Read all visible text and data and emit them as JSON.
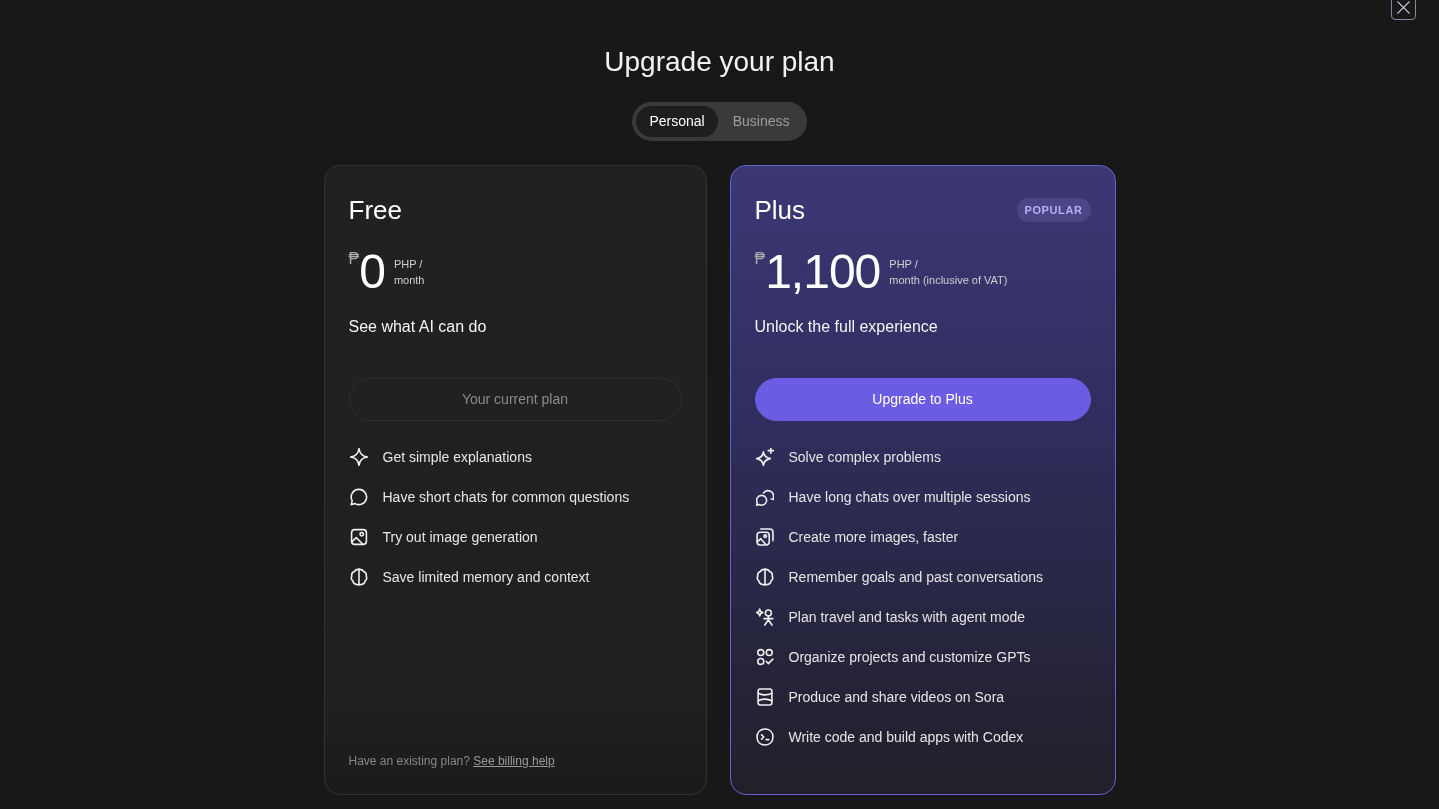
{
  "title": "Upgrade your plan",
  "tabs": [
    {
      "label": "Personal",
      "selected": true
    },
    {
      "label": "Business",
      "selected": false
    }
  ],
  "plans": [
    {
      "name": "Free",
      "highlighted": false,
      "currency": "₱",
      "price": "0",
      "period": [
        "PHP /",
        "month"
      ],
      "tagline": "See what AI can do",
      "button": {
        "label": "Your current plan",
        "disabled": true
      },
      "features": [
        "Get simple explanations",
        "Have short chats for common questions",
        "Try out image generation",
        "Save limited memory and context"
      ],
      "footer": {
        "text": "Have an existing plan?",
        "link": "See billing help"
      }
    },
    {
      "name": "Plus",
      "highlighted": true,
      "badge": "POPULAR",
      "currency": "₱",
      "price": "1,100",
      "period": [
        "PHP /",
        "month (inclusive of VAT)"
      ],
      "tagline": "Unlock the full experience",
      "button": {
        "label": "Upgrade to Plus",
        "disabled": false
      },
      "features": [
        "Solve complex problems",
        "Have long chats over multiple sessions",
        "Create more images, faster",
        "Remember goals and past conversations",
        "Plan travel and tasks with agent mode",
        "Organize projects and customize GPTs",
        "Produce and share videos on Sora",
        "Write code and build apps with Codex"
      ]
    }
  ]
}
